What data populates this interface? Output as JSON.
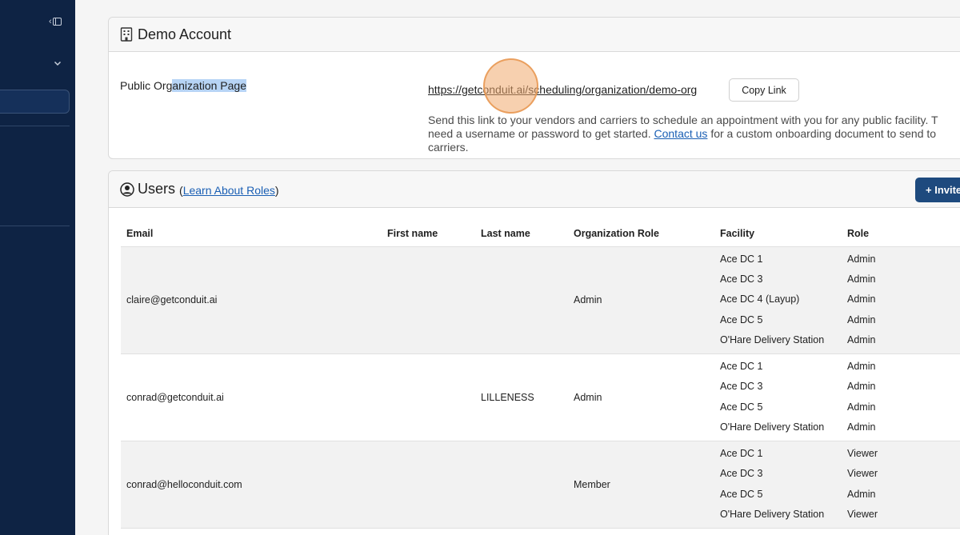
{
  "sidebar": {},
  "org_card": {
    "title": "Demo Account",
    "label_plain": "Public Org",
    "label_highlighted": "anization Page",
    "url": "https://getconduit.ai/scheduling/organization/demo-org",
    "copy_label": "Copy Link",
    "desc_before": "Send this link to your vendors and carriers to schedule an appointment with you for any public facility. T",
    "desc_line2": "need a username or password to get started.",
    "desc_link": "Contact us",
    "desc_after": "for a custom onboarding document to send to",
    "desc_line3": "carriers."
  },
  "users_card": {
    "title": "Users",
    "open_paren": "(",
    "roles_link": "Learn About Roles",
    "close_paren": ")",
    "invite_label": "+ Invite",
    "columns": [
      "Email",
      "First name",
      "Last name",
      "Organization Role",
      "Facility",
      "Role"
    ],
    "rows": [
      {
        "email": "claire@getconduit.ai",
        "first_name": "",
        "last_name": "",
        "org_role": "Admin",
        "facilities": [
          "Ace DC 1",
          "Ace DC 3",
          "Ace DC 4 (Layup)",
          "Ace DC 5",
          "O'Hare Delivery Station"
        ],
        "roles": [
          "Admin",
          "Admin",
          "Admin",
          "Admin",
          "Admin"
        ]
      },
      {
        "email": "conrad@getconduit.ai",
        "first_name": "",
        "last_name": "LILLENESS",
        "org_role": "Admin",
        "facilities": [
          "Ace DC 1",
          "Ace DC 3",
          "Ace DC 5",
          "O'Hare Delivery Station"
        ],
        "roles": [
          "Admin",
          "Admin",
          "Admin",
          "Admin"
        ]
      },
      {
        "email": "conrad@helloconduit.com",
        "first_name": "",
        "last_name": "",
        "org_role": "Member",
        "facilities": [
          "Ace DC 1",
          "Ace DC 3",
          "Ace DC 5",
          "O'Hare Delivery Station"
        ],
        "roles": [
          "Viewer",
          "Viewer",
          "Admin",
          "Viewer"
        ]
      }
    ]
  }
}
